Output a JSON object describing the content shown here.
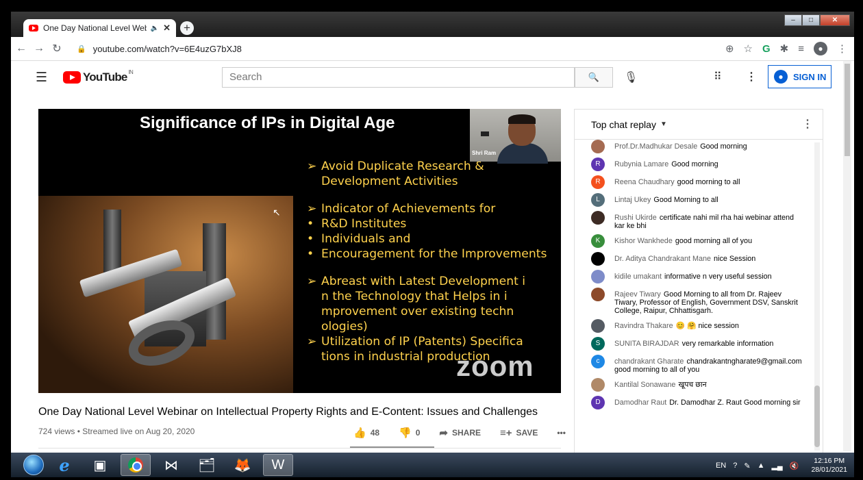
{
  "browser": {
    "tab_title": "One Day National Level Web",
    "tab_speaker_icon": "speaker-icon",
    "tab_close": "✕",
    "new_tab": "+",
    "url": "youtube.com/watch?v=6E4uzG7bXJ8"
  },
  "youtube": {
    "logo_text": "YouTube",
    "region": "IN",
    "search_placeholder": "Search",
    "sign_in": "SIGN IN"
  },
  "video": {
    "slide_title": "Significance of IPs in Digital Age",
    "bullets": [
      {
        "marker": "➢",
        "text": "Avoid Duplicate Research &"
      },
      {
        "marker": "",
        "text": "Development Activities"
      },
      {
        "marker": "➢",
        "text": "Indicator of Achievements for"
      },
      {
        "marker": "•",
        "text": "R&D Institutes"
      },
      {
        "marker": "•",
        "text": "Individuals and"
      },
      {
        "marker": "•",
        "text": "Encouragement for the Improvements"
      },
      {
        "marker": "➢",
        "text": "Abreast with Latest Development i"
      },
      {
        "marker": "",
        "text": "n  the  Technology that Helps in i"
      },
      {
        "marker": "",
        "text": "mprovement   over existing techn"
      },
      {
        "marker": "",
        "text": "ologies)"
      },
      {
        "marker": "➢",
        "text": "Utilization of IP (Patents) Specifica"
      },
      {
        "marker": "",
        "text": "tions in industrial production"
      }
    ],
    "speaker_name": "Shri Ram",
    "watermark": "zoom",
    "title": "One Day National Level Webinar on Intellectual Property Rights and E-Content: Issues and Challenges",
    "meta": "724 views • Streamed live on Aug 20, 2020",
    "likes": "48",
    "dislikes": "0",
    "share": "SHARE",
    "save": "SAVE",
    "more": "•••"
  },
  "chat": {
    "header": "Top chat replay",
    "messages": [
      {
        "author": "Prof.Dr.Madhukar Desale",
        "text": "Good morning",
        "avatar": "",
        "color": "#a56b52"
      },
      {
        "author": "Rubynia Lamare",
        "text": "Good morning",
        "avatar": "R",
        "color": "#5e35b1"
      },
      {
        "author": "Reena Chaudhary",
        "text": "good morning to all",
        "avatar": "R",
        "color": "#f4511e"
      },
      {
        "author": "Lintaj Ukey",
        "text": "Good Morning to all",
        "avatar": "L",
        "color": "#546e7a"
      },
      {
        "author": "Rushi Ukirde",
        "text": "certificate nahi mil rha hai webinar attend kar ke bhi",
        "avatar": "",
        "color": "#3d2b24"
      },
      {
        "author": "Kishor Wankhede",
        "text": "good morning all of you",
        "avatar": "K",
        "color": "#388e3c"
      },
      {
        "author": "Dr. Aditya Chandrakant Mane",
        "text": "nice Session",
        "avatar": "",
        "color": "#000000"
      },
      {
        "author": "kidile umakant",
        "text": "informative n very useful session",
        "avatar": "",
        "color": "#7e8cc9"
      },
      {
        "author": "Rajeev Tiwary",
        "text": "Good Morning to all from Dr. Rajeev Tiwary, Professor of English, Government DSV, Sanskrit College, Raipur, Chhattisgarh.",
        "avatar": "",
        "color": "#8d4a2a"
      },
      {
        "author": "Ravindra Thakare",
        "text": "😊 🤗 nice session",
        "avatar": "",
        "color": "#555b63"
      },
      {
        "author": "SUNITA BIRAJDAR",
        "text": "very remarkable information",
        "avatar": "S",
        "color": "#00695c"
      },
      {
        "author": "chandrakant Gharate",
        "text": "chandrakantngharate9@gmail.com good morning to all of you",
        "avatar": "c",
        "color": "#1e88e5"
      },
      {
        "author": "Kantilal Sonawane",
        "text": "खूपच छान",
        "avatar": "",
        "color": "#b08968"
      },
      {
        "author": "Damodhar Raut",
        "text": "Dr. Damodhar Z. Raut Good morning sir",
        "avatar": "D",
        "color": "#5e35b1"
      }
    ]
  },
  "taskbar": {
    "lang": "EN",
    "time": "12:16 PM",
    "date": "28/01/2021"
  }
}
